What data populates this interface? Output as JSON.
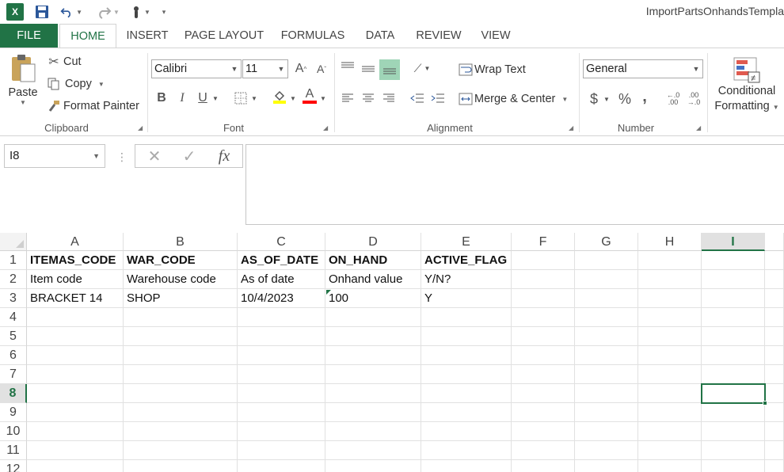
{
  "title_bar": {
    "doc_title": "ImportPartsOnhandsTempla",
    "app_icon": "excel-icon",
    "qat": [
      "save-icon",
      "undo-icon",
      "redo-icon",
      "touch-mode-icon",
      "customize-qat-icon"
    ]
  },
  "tabs": [
    {
      "label": "FILE"
    },
    {
      "label": "HOME"
    },
    {
      "label": "INSERT"
    },
    {
      "label": "PAGE LAYOUT"
    },
    {
      "label": "FORMULAS"
    },
    {
      "label": "DATA"
    },
    {
      "label": "REVIEW"
    },
    {
      "label": "VIEW"
    }
  ],
  "ribbon": {
    "clipboard": {
      "paste_label": "Paste",
      "cut_label": "Cut",
      "copy_label": "Copy",
      "format_painter_label": "Format Painter",
      "group_label": "Clipboard"
    },
    "font": {
      "font_name": "Calibri",
      "font_size": "11",
      "bold": "B",
      "italic": "I",
      "underline": "U",
      "font_color_letter": "A",
      "group_label": "Font"
    },
    "alignment": {
      "wrap_text_label": "Wrap Text",
      "merge_center_label": "Merge & Center",
      "group_label": "Alignment"
    },
    "number": {
      "format_value": "General",
      "currency": "$",
      "percent": "%",
      "comma": ",",
      "group_label": "Number"
    },
    "styles": {
      "conditional_line1": "Conditional",
      "conditional_line2": "Formatting"
    }
  },
  "formula_bar": {
    "name_box": "I8",
    "fx_label": "fx",
    "formula_value": ""
  },
  "sheet": {
    "columns": [
      "A",
      "B",
      "C",
      "D",
      "E",
      "F",
      "G",
      "H",
      "I"
    ],
    "active_column": "I",
    "rows": [
      "1",
      "2",
      "3",
      "4",
      "5",
      "6",
      "7",
      "8",
      "9",
      "10",
      "11",
      "12"
    ],
    "active_row": "8",
    "cells": {
      "r1": [
        "ITEMAS_CODE",
        "WAR_CODE",
        "AS_OF_DATE",
        "ON_HAND",
        "ACTIVE_FLAG",
        "",
        "",
        "",
        ""
      ],
      "r2": [
        "Item code",
        "Warehouse code",
        "As of date",
        "Onhand value",
        "Y/N?",
        "",
        "",
        "",
        ""
      ],
      "r3": [
        "BRACKET 14",
        "SHOP",
        "10/4/2023",
        "100",
        "Y",
        "",
        "",
        "",
        ""
      ]
    },
    "selected_cell": "I8"
  },
  "colors": {
    "excel_green": "#217346",
    "font_color_swatch": "#ff0000",
    "fill_color_swatch": "#ffff00"
  }
}
